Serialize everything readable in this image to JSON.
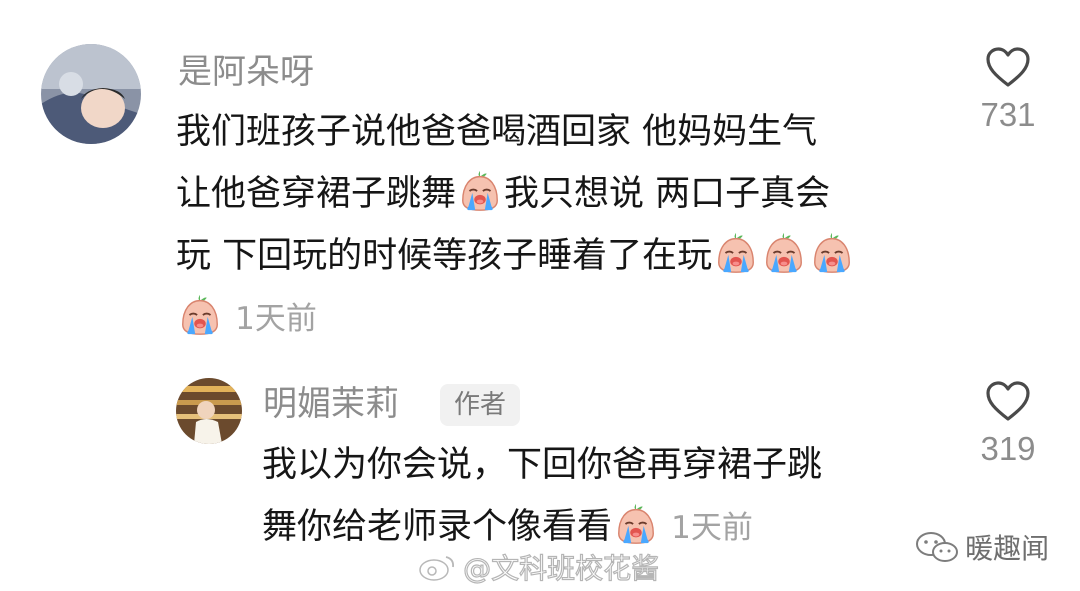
{
  "comment": {
    "username": "是阿朵呀",
    "lines": [
      "我们班孩子说他爸爸喝酒回家 他妈妈生气",
      [
        "让他爸穿裙子跳舞",
        "我只想说 两口子真会"
      ],
      "玩 下回玩的时候等孩子睡着了在玩"
    ],
    "time": "1天前",
    "likes": "731"
  },
  "reply": {
    "username": "明媚茉莉",
    "badge": "作者",
    "lines": [
      "我以为你会说，下回你爸再穿裙子跳",
      "舞你给老师录个像看看"
    ],
    "time": "1天前",
    "likes": "319"
  },
  "watermarks": {
    "weibo": "@文科班校花酱",
    "wechat": "暖趣闻"
  }
}
